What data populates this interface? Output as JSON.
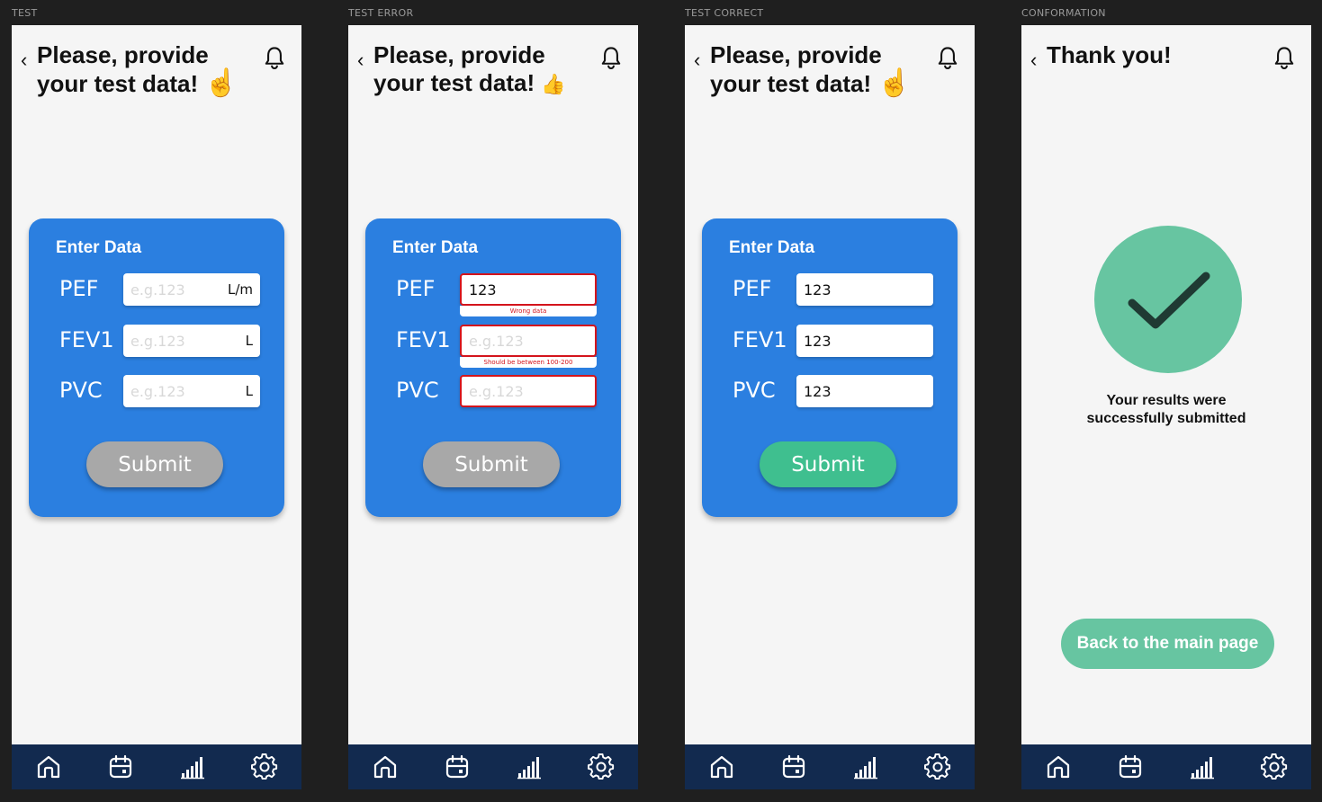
{
  "frames": [
    {
      "label": "TEST",
      "title_line1": "Please, provide",
      "title_line2": "your test data!",
      "emoji": "☝️",
      "card_title": "Enter Data",
      "rows": [
        {
          "label": "PEF",
          "value": "",
          "placeholder": "e.g.123",
          "unit": "L/m"
        },
        {
          "label": "FEV1",
          "value": "",
          "placeholder": "e.g.123",
          "unit": "L"
        },
        {
          "label": "PVC",
          "value": "",
          "placeholder": "e.g.123",
          "unit": "L"
        }
      ],
      "submit_label": "Submit",
      "submit_state": "disabled"
    },
    {
      "label": "TEST ERROR",
      "title_line1": "Please, provide",
      "title_line2": "your test data!",
      "emoji": "👍",
      "card_title": "Enter Data",
      "rows": [
        {
          "label": "PEF",
          "value": "123",
          "placeholder": "e.g.123",
          "error": "Wrong data"
        },
        {
          "label": "FEV1",
          "value": "",
          "placeholder": "e.g.123",
          "error": "Should be between 100-200"
        },
        {
          "label": "PVC",
          "value": "",
          "placeholder": "e.g.123",
          "error": ""
        }
      ],
      "submit_label": "Submit",
      "submit_state": "disabled"
    },
    {
      "label": "TEST CORRECT",
      "title_line1": "Please, provide",
      "title_line2": "your test data!",
      "emoji": "☝️",
      "card_title": "Enter Data",
      "rows": [
        {
          "label": "PEF",
          "value": "123",
          "placeholder": "e.g.123"
        },
        {
          "label": "FEV1",
          "value": "123",
          "placeholder": "e.g.123"
        },
        {
          "label": "PVC",
          "value": "123",
          "placeholder": "e.g.123"
        }
      ],
      "submit_label": "Submit",
      "submit_state": "enabled"
    },
    {
      "label": "CONFORMATION",
      "title": "Thank you!",
      "message_line1": "Your results were",
      "message_line2": "successfully submitted",
      "button_label": "Back to the main page"
    }
  ],
  "nav": [
    "home-icon",
    "calendar-icon",
    "stats-icon",
    "settings-icon"
  ],
  "colors": {
    "card": "#2b7fe0",
    "navbar": "#122a4f",
    "success_green": "#67c5a1",
    "submit_green": "#3fbf8f",
    "submit_grey": "#a8a8a8",
    "error_red": "#d4141c"
  }
}
